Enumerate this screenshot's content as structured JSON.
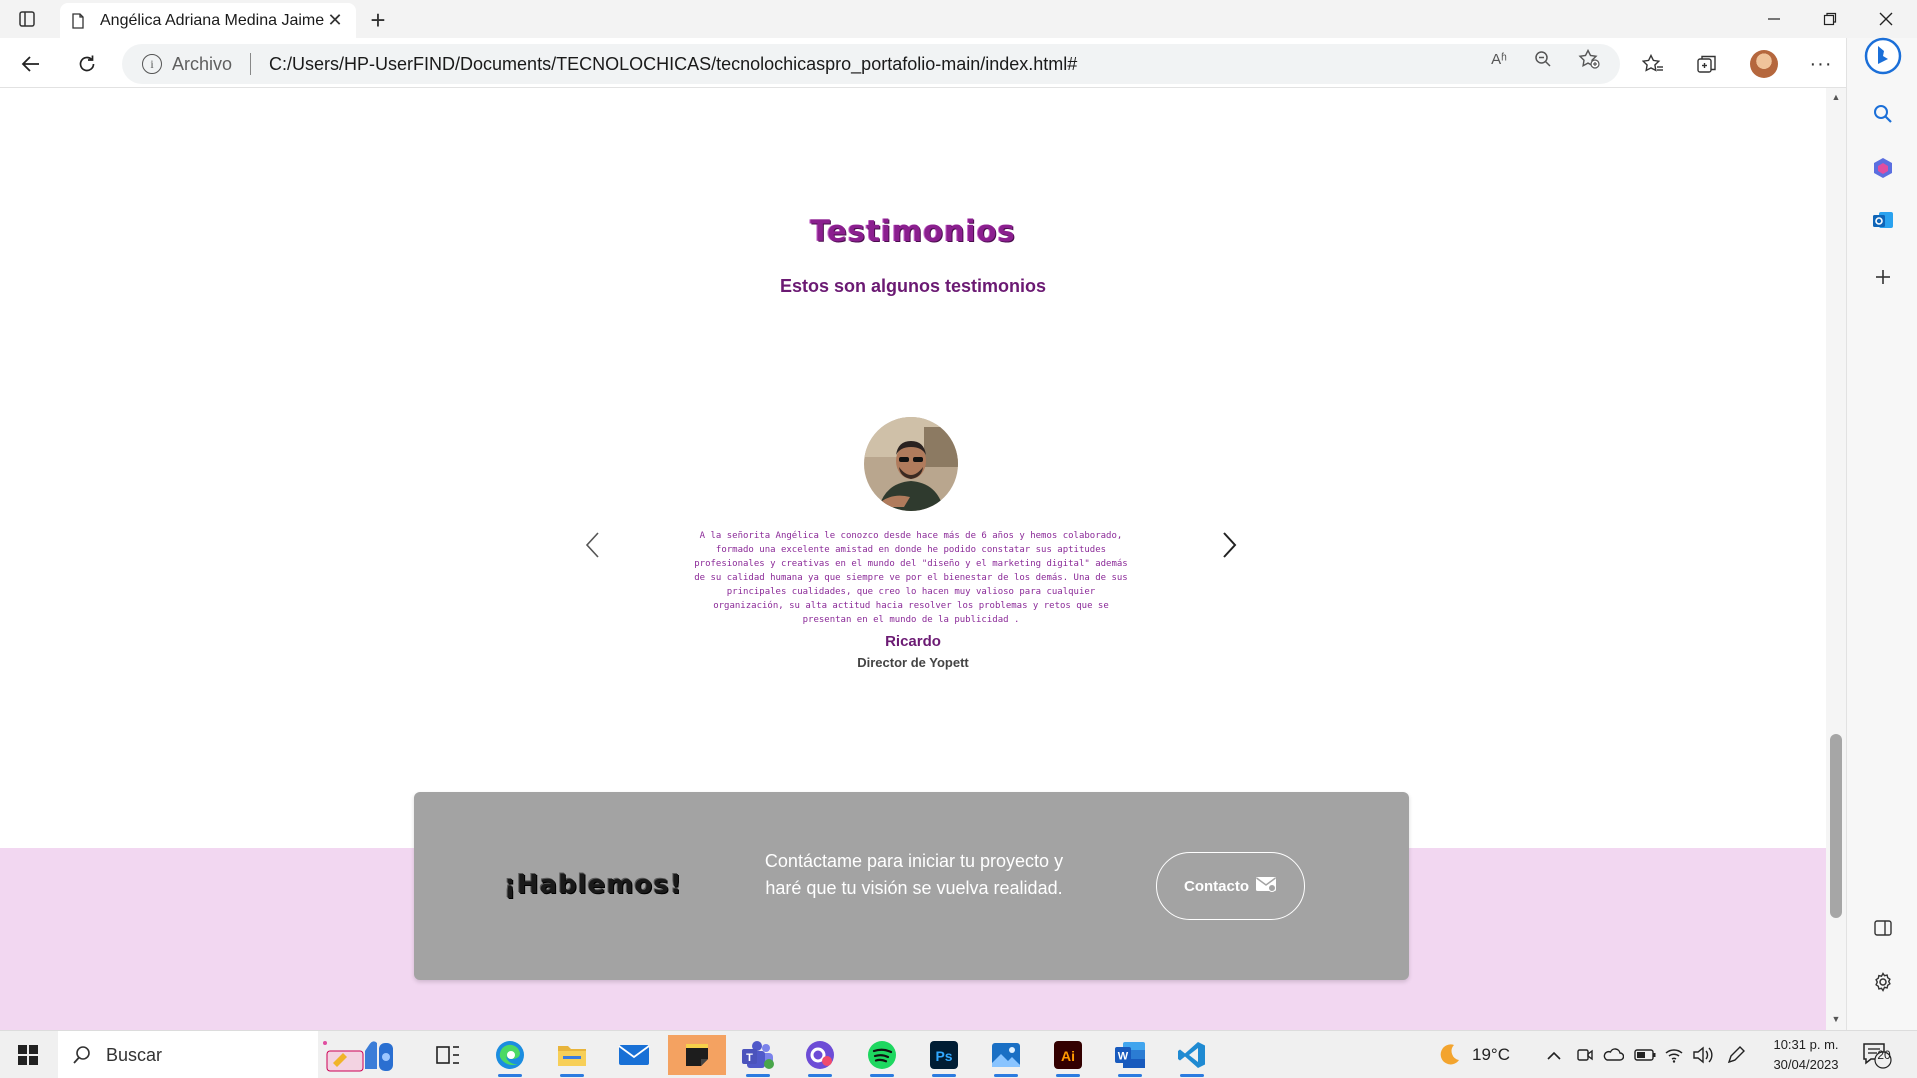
{
  "browser": {
    "tab_title": "Angélica Adriana Medina Jaime |",
    "url_protocol": "Archivo",
    "url": "C:/Users/HP-UserFIND/Documents/TECNOLOCHICAS/tecnolochicaspro_portafolio-main/index.html#",
    "read_aloud_icon": "Aʱ"
  },
  "testimonials": {
    "title": "Testimonios",
    "subtitle": "Estos son algunos testimonios",
    "quote": "A la señorita Angélica le conozco desde hace más de 6 años y hemos colaborado, formado una excelente amistad en donde he podido constatar sus aptitudes profesionales y creativas en el mundo del \"diseño y el marketing digital\" además de su calidad humana ya que siempre ve por el bienestar de los demás. Una de sus principales cualidades, que creo lo hacen muy valioso para cualquier organización, su alta actitud hacia resolver los problemas y retos que se presentan en el mundo de la publicidad .",
    "name": "Ricardo",
    "role": "Director de Yopett"
  },
  "cta": {
    "title": "¡Hablemos!",
    "text": "Contáctame para iniciar tu proyecto y haré que tu visión se vuelva realidad.",
    "button_label": "Contacto"
  },
  "taskbar": {
    "search_label": "Buscar",
    "weather": "19°C",
    "time": "10:31 p. m.",
    "date": "30/04/2023",
    "notifications": "20"
  },
  "colors": {
    "accent": "#8b1f8f",
    "footer_band": "#f2d7f1",
    "cta_box": "#a3a3a3"
  }
}
